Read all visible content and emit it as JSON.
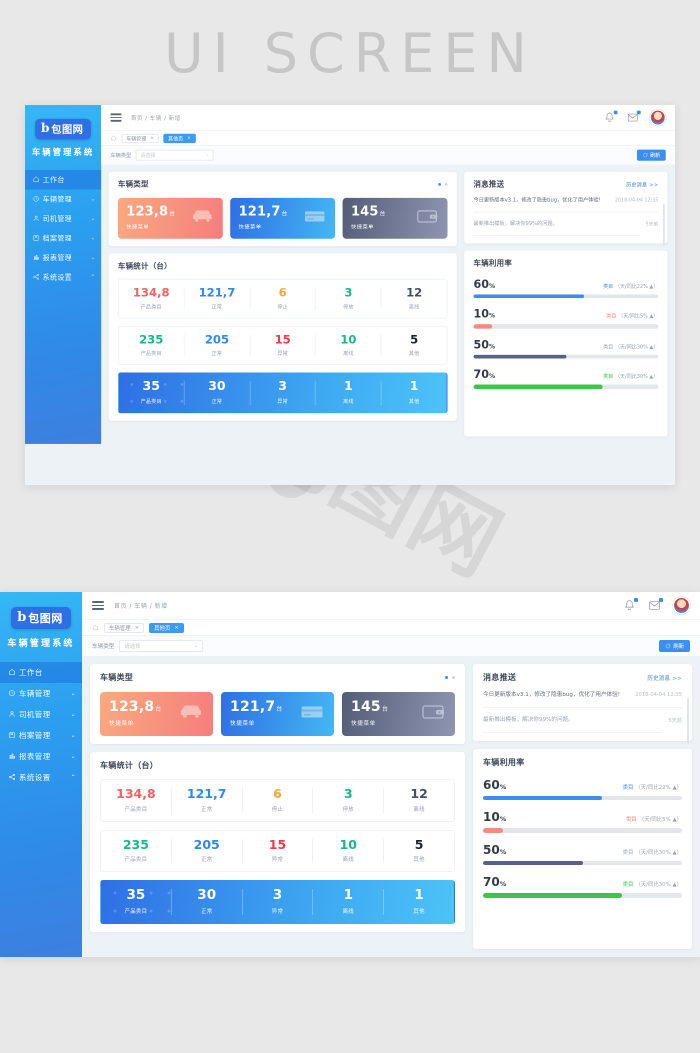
{
  "watermark": {
    "title": "UI SCREEN",
    "brand": "包图网"
  },
  "sidebar": {
    "logo_mark": "b",
    "logo_text": "包图网",
    "system_name": "车辆管理系统",
    "items": [
      {
        "label": "工作台",
        "icon": "home-icon",
        "arrow": "",
        "active": true
      },
      {
        "label": "车辆管理",
        "icon": "clock-icon",
        "arrow": "⌄",
        "active": false
      },
      {
        "label": "司机管理",
        "icon": "user-icon",
        "arrow": "⌄",
        "active": false
      },
      {
        "label": "档案管理",
        "icon": "folder-icon",
        "arrow": "⌄",
        "active": false
      },
      {
        "label": "报表管理",
        "icon": "chart-icon",
        "arrow": "⌄",
        "active": false
      },
      {
        "label": "系统设置",
        "icon": "share-icon",
        "arrow": "⌃",
        "active": false
      }
    ]
  },
  "topbar": {
    "menu_icon": "hamburger-icon",
    "breadcrumb": "首页 / 车辆 / 新增",
    "bell_icon": "bell-icon",
    "mail_icon": "mail-icon",
    "avatar": "user-avatar"
  },
  "tabbar": {
    "home_icon": "home-outline-icon",
    "tabs": [
      {
        "label": "车辆管理",
        "close": "×",
        "active": false
      },
      {
        "label": "其他页",
        "close": "×",
        "active": true
      }
    ]
  },
  "filterbar": {
    "label": "车辆类型",
    "select_value": "",
    "select_placeholder": "请选择",
    "caret": "⌄",
    "refresh_label": "刷新",
    "refresh_icon": "refresh-icon"
  },
  "vehicle_types": {
    "title": "车辆类型",
    "pager": {
      "active_index": 0,
      "count": 2
    },
    "cards": [
      {
        "value": "123,8",
        "unit": "台",
        "sub": "快捷菜单",
        "icon": "car-icon",
        "color": "#f57e7d"
      },
      {
        "value": "121,7",
        "unit": "台",
        "sub": "快捷菜单",
        "icon": "card-icon",
        "color": "#2f6fe4"
      },
      {
        "value": "145",
        "unit": "台",
        "sub": "快捷菜单",
        "icon": "wallet-icon",
        "color": "#545d78"
      }
    ]
  },
  "vehicle_stats": {
    "title": "车辆统计（台）",
    "rows": [
      {
        "highlight": false,
        "cells": [
          {
            "num": "134,8",
            "label": "产品类目",
            "color": "#f2635f"
          },
          {
            "num": "121,7",
            "label": "正常",
            "color": "#2f8ae8"
          },
          {
            "num": "6",
            "label": "停止",
            "color": "#f0a93c"
          },
          {
            "num": "3",
            "label": "停放",
            "color": "#18b887"
          },
          {
            "num": "12",
            "label": "离线",
            "color": "#454f63"
          }
        ]
      },
      {
        "highlight": false,
        "cells": [
          {
            "num": "235",
            "label": "产品类目",
            "color": "#18b887"
          },
          {
            "num": "205",
            "label": "正常",
            "color": "#2f8ae8"
          },
          {
            "num": "15",
            "label": "异常",
            "color": "#ec3b4c"
          },
          {
            "num": "10",
            "label": "离线",
            "color": "#18b887"
          },
          {
            "num": "5",
            "label": "其他",
            "color": "#1c2230"
          }
        ]
      },
      {
        "highlight": true,
        "cells": [
          {
            "num": "35",
            "label": "产品类目",
            "color": "#ffffff"
          },
          {
            "num": "30",
            "label": "正常",
            "color": "#ffffff"
          },
          {
            "num": "3",
            "label": "异常",
            "color": "#ffffff"
          },
          {
            "num": "1",
            "label": "离线",
            "color": "#ffffff"
          },
          {
            "num": "1",
            "label": "其他",
            "color": "#ffffff"
          }
        ]
      }
    ]
  },
  "messages": {
    "title": "消息推送",
    "more_label": "历史消息 >>",
    "items": [
      {
        "text": "今日更新版本v3.1，修改了隐患bug，优化了用户体验!",
        "date": "2018-04-04",
        "time": "12:35",
        "muted": false
      },
      {
        "text": "最新推出模板，解决你99%的问题。",
        "date": "5天前",
        "time": "",
        "muted": true
      }
    ]
  },
  "utilization": {
    "title": "车辆利用率",
    "bars": [
      {
        "pct": "60",
        "pct_unit": "%",
        "value": 60,
        "cat": "类目",
        "note": "（天/同比22% ▲）",
        "color": "#3c8ff0",
        "cat_color": "#3c8ff0"
      },
      {
        "pct": "10",
        "pct_unit": "%",
        "value": 10,
        "cat": "类目",
        "note": "（天/同比5% ▲）",
        "color": "#f8897f",
        "cat_color": "#f8897f"
      },
      {
        "pct": "50",
        "pct_unit": "%",
        "value": 50,
        "cat": "类目",
        "note": "（天/同比30% ▲）",
        "color": "#5b6185",
        "cat_color": "#9aa4b1"
      },
      {
        "pct": "70",
        "pct_unit": "%",
        "value": 70,
        "cat": "类目",
        "note": "（天/同比30% ▲）",
        "color": "#3fc44a",
        "cat_color": "#3fc44a"
      }
    ]
  }
}
